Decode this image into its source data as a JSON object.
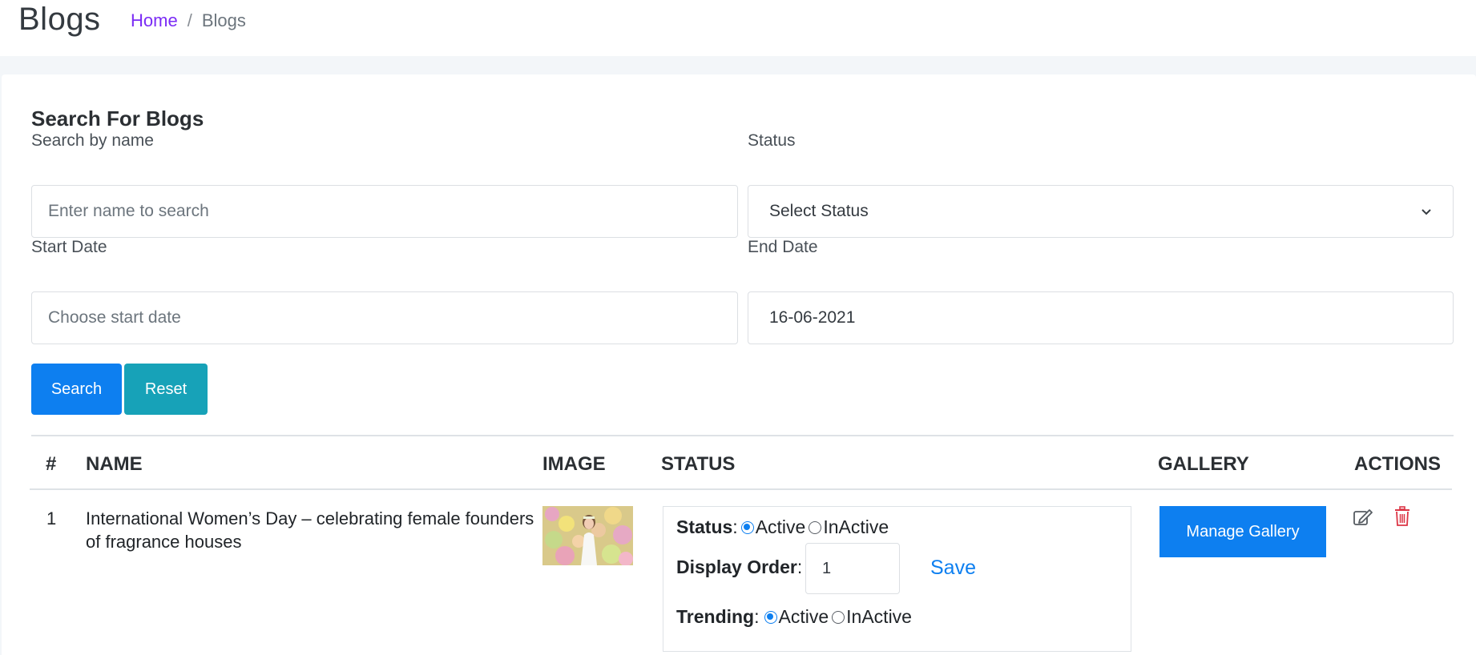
{
  "header": {
    "title": "Blogs",
    "breadcrumb": {
      "home": "Home",
      "separator": "/",
      "current": "Blogs"
    }
  },
  "search": {
    "title": "Search For Blogs",
    "name_label": "Search by name",
    "name_placeholder": "Enter name to search",
    "status_label": "Status",
    "status_selected": "Select Status",
    "start_label": "Start Date",
    "start_placeholder": "Choose start date",
    "end_label": "End Date",
    "end_value": "16-06-2021",
    "search_button": "Search",
    "reset_button": "Reset"
  },
  "table": {
    "columns": [
      "#",
      "NAME",
      "IMAGE",
      "STATUS",
      "GALLERY",
      "ACTIONS"
    ],
    "rows": [
      {
        "index": "1",
        "name": "International Women’s Day – celebrating female founders of fragrance houses",
        "status_label": "Status",
        "status_options": [
          "Active",
          "InActive"
        ],
        "status_selected": "Active",
        "display_order_label": "Display Order",
        "display_order": "1",
        "save_label": "Save",
        "trending_label": "Trending",
        "trending_options": [
          "Active",
          "InActive"
        ],
        "trending_selected": "Active",
        "gallery_button": "Manage Gallery",
        "actions": [
          "edit-icon",
          "trash-icon"
        ]
      }
    ]
  },
  "colors": {
    "primary": "#0d7ff0",
    "info": "#17a2b8",
    "breadcrumb_link": "#7b2cf5",
    "danger": "#dc3545"
  }
}
